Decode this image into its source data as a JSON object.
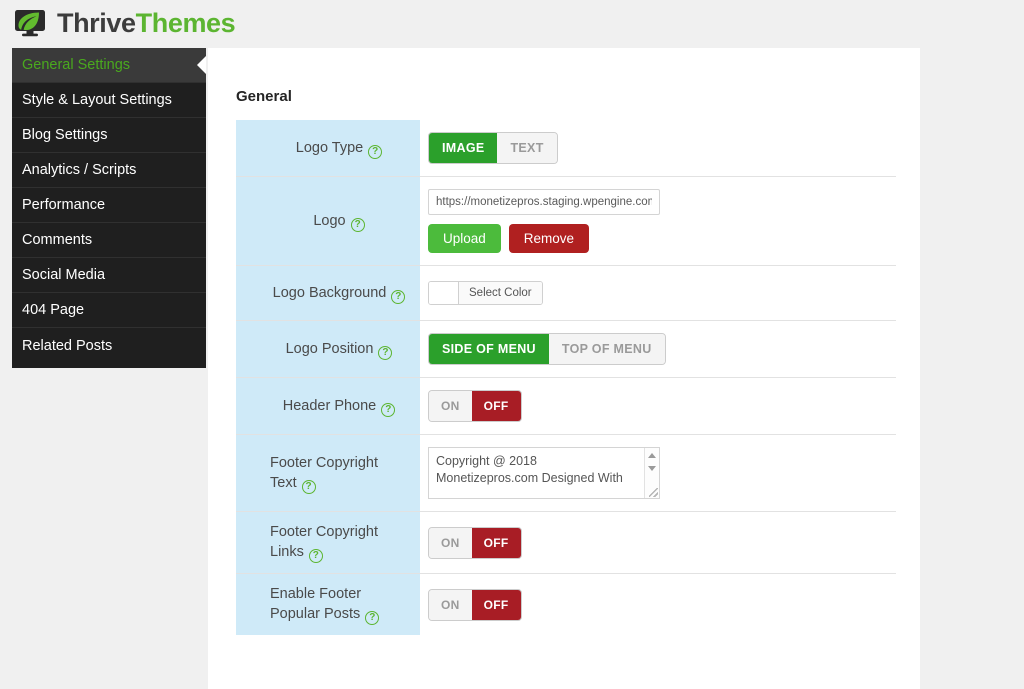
{
  "brand": {
    "name_dark": "Thrive",
    "name_green": "Themes",
    "logo_icon": "leaf-monitor-icon",
    "green": "#5cb531",
    "dark": "#3c3c3c"
  },
  "sidebar": {
    "items": [
      {
        "label": "General Settings",
        "active": true
      },
      {
        "label": "Style & Layout Settings",
        "active": false
      },
      {
        "label": "Blog Settings",
        "active": false
      },
      {
        "label": "Analytics / Scripts",
        "active": false
      },
      {
        "label": "Performance",
        "active": false
      },
      {
        "label": "Comments",
        "active": false
      },
      {
        "label": "Social Media",
        "active": false
      },
      {
        "label": "404 Page",
        "active": false
      },
      {
        "label": "Related Posts",
        "active": false
      }
    ]
  },
  "main": {
    "section_title": "General",
    "rows": {
      "logo_type": {
        "label": "Logo Type",
        "options": [
          "IMAGE",
          "TEXT"
        ],
        "selected": "IMAGE"
      },
      "logo": {
        "label": "Logo",
        "url_value": "https://monetizepros.staging.wpengine.com/w",
        "upload_label": "Upload",
        "remove_label": "Remove"
      },
      "logo_background": {
        "label": "Logo Background",
        "button_label": "Select Color",
        "swatch_color": "#ffffff"
      },
      "logo_position": {
        "label": "Logo Position",
        "options": [
          "SIDE OF MENU",
          "TOP OF MENU"
        ],
        "selected": "SIDE OF MENU"
      },
      "header_phone": {
        "label": "Header Phone",
        "on_label": "ON",
        "off_label": "OFF",
        "state": "OFF"
      },
      "footer_copyright_text": {
        "label": "Footer Copyright Text",
        "value": "Copyright @ 2018\nMonetizepros.com Designed With"
      },
      "footer_copyright_links": {
        "label": "Footer Copyright Links",
        "on_label": "ON",
        "off_label": "OFF",
        "state": "OFF"
      },
      "enable_footer_popular_posts": {
        "label": "Enable Footer Popular Posts",
        "on_label": "ON",
        "off_label": "OFF",
        "state": "OFF"
      }
    }
  },
  "theme": {
    "label_bg": "#cfeaf8",
    "sidebar_bg": "#1f1f1f",
    "active_green": "#4aa91e",
    "toggle_green": "#2ba02b",
    "toggle_red": "#a81d25",
    "upload_green": "#4cbb3c",
    "remove_red": "#b02020",
    "page_bg": "#f0f0f0"
  }
}
